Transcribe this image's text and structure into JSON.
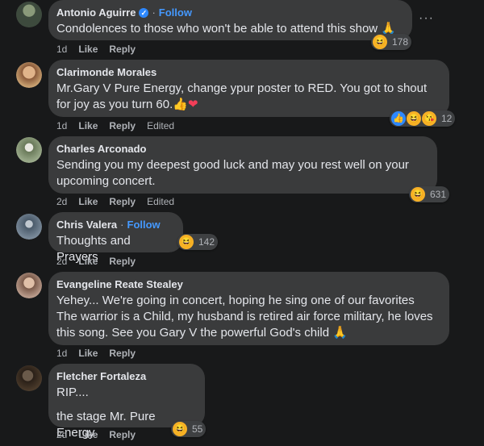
{
  "comments": [
    {
      "author": "Antonio Aguirre",
      "verified": true,
      "follow": "Follow",
      "text": "Condolences to those who won't be able to attend this show",
      "text_emoji": "🙏",
      "time": "1d",
      "like": "Like",
      "reply": "Reply",
      "reaction_count": "178",
      "avatar_color": "#4a5a4a"
    },
    {
      "author": "Clarimonde Morales",
      "text_line1": "Mr.Gary V Pure Energy, change ypur poster to RED. You got to shout",
      "text_line2": "for joy as you turn 60.",
      "text_emoji1": "👍",
      "text_emoji2": "❤",
      "time": "1d",
      "like": "Like",
      "reply": "Reply",
      "edited": "Edited",
      "reaction_count": "12",
      "avatar_color": "#c9a06a"
    },
    {
      "author": "Charles Arconado",
      "text_line1": "Sending you my deepest good luck and may you rest well on your",
      "text_line2": "upcoming concert.",
      "time": "2d",
      "like": "Like",
      "reply": "Reply",
      "edited": "Edited",
      "reaction_count": "631",
      "avatar_color": "#7a8a6a"
    },
    {
      "author": "Chris Valera",
      "follow": "Follow",
      "text": "Thoughts and Prayers",
      "time": "2d",
      "like": "Like",
      "reply": "Reply",
      "reaction_count": "142",
      "avatar_color": "#5a6a7a"
    },
    {
      "author": "Evangeline Reate Stealey",
      "text_line1": "Yehey... We're going in concert, hoping he sing one of our favorites",
      "text_line2": "The warrior is a Child, my husband is retired air force military, he loves",
      "text_line3": "this song. See you Gary V the powerful God's child",
      "text_emoji": "🙏",
      "time": "1d",
      "like": "Like",
      "reply": "Reply",
      "avatar_color": "#b08a7a"
    },
    {
      "author": "Fletcher Fortaleza",
      "text_line1": "RIP....",
      "text_line2": "the stage Mr. Pure Energy",
      "time": "2d",
      "like": "Like",
      "reply": "Reply",
      "reaction_count": "55",
      "avatar_color": "#4a3a2a"
    }
  ],
  "icons": {
    "more": "more-horizontal-icon",
    "haha": "haha-reaction-icon",
    "like": "like-reaction-icon",
    "wow": "wow-reaction-icon"
  },
  "colors": {
    "background": "#18191a",
    "bubble": "#3a3b3c",
    "link_blue": "#4599ff",
    "verified_blue": "#2d88ff"
  }
}
